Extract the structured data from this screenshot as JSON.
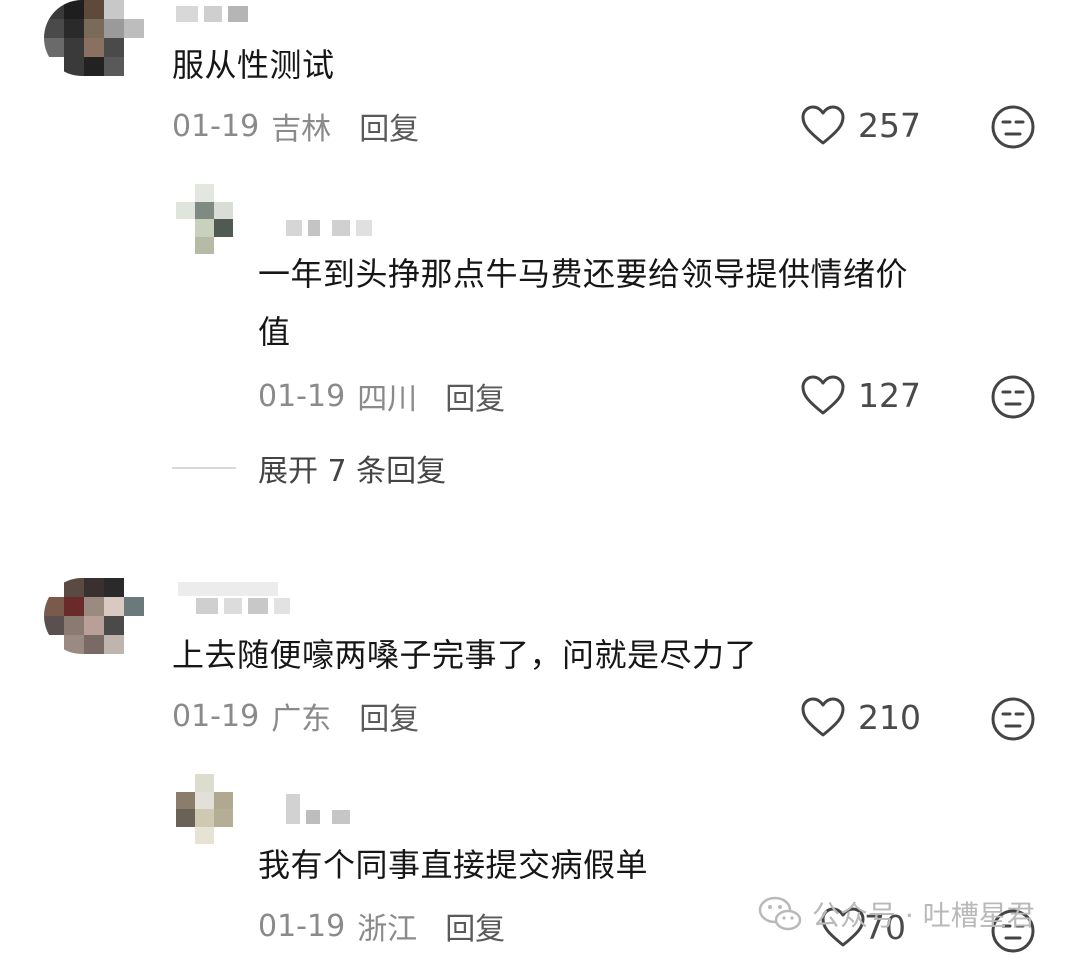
{
  "comments": [
    {
      "text": "服从性测试",
      "date": "01-19",
      "location": "吉林",
      "reply_label": "回复",
      "likes": "257",
      "replies": [
        {
          "text_line1": "一年到头挣那点牛马费还要给领导提供情绪价",
          "text_line2": "值",
          "date": "01-19",
          "location": "四川",
          "reply_label": "回复",
          "likes": "127"
        }
      ],
      "expand_label": "展开 7 条回复"
    },
    {
      "text": "上去随便嚎两嗓子完事了，问就是尽力了",
      "date": "01-19",
      "location": "广东",
      "reply_label": "回复",
      "likes": "210",
      "replies": [
        {
          "text": "我有个同事直接提交病假单",
          "date": "01-19",
          "location": "浙江",
          "reply_label": "回复",
          "likes": "70"
        }
      ]
    }
  ],
  "watermark": "公众号 · 吐槽星君",
  "icons": {
    "like": "heart-outline-icon",
    "emoji": "neutral-face-icon",
    "watermark": "wechat-icon"
  }
}
